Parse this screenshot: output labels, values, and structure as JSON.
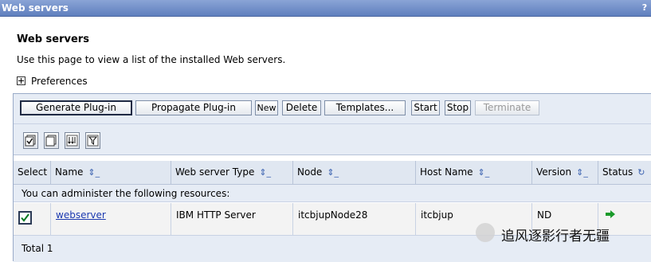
{
  "window": {
    "title": "Web servers",
    "help": "?"
  },
  "page": {
    "title": "Web servers",
    "description": "Use this page to view a list of the installed Web servers.",
    "preferences": "Preferences"
  },
  "buttons": {
    "generate": "Generate Plug-in",
    "propagate": "Propagate Plug-in",
    "new": "New",
    "delete": "Delete",
    "templates": "Templates...",
    "start": "Start",
    "stop": "Stop",
    "terminate": "Terminate"
  },
  "icons": [
    "select-all-icon",
    "deselect-all-icon",
    "show-filter-icon",
    "clear-filter-icon"
  ],
  "table": {
    "columns": [
      "Select",
      "Name",
      "Web server Type",
      "Node",
      "Host Name",
      "Version",
      "Status"
    ],
    "resource_caption": "You can administer the following resources:",
    "rows": [
      {
        "name": "webserver",
        "type": "IBM HTTP Server",
        "node": "itcbjupNode28",
        "host": "itcbjup",
        "version": "ND",
        "status": "started"
      }
    ],
    "total": "Total 1"
  },
  "watermark": "追风逐影行者无疆",
  "colors": {
    "titlebar": "#6f8cc8",
    "link": "#1c3ab0",
    "status_started": "#1a9a2a"
  }
}
